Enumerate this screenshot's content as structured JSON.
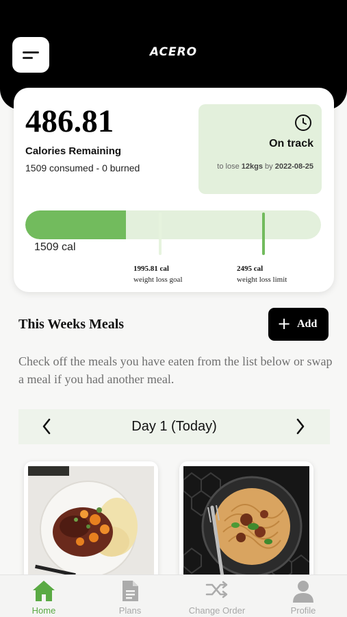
{
  "header": {
    "app_title": "ACERO"
  },
  "summary": {
    "calories_remaining_value": "486.81",
    "calories_remaining_label": "Calories Remaining",
    "consumed_burned": "1509 consumed - 0 burned",
    "status": "On track",
    "goal_prefix": "to lose",
    "goal_amount": "12kgs",
    "goal_by": "by",
    "goal_date": "2022-08-25",
    "progress_fraction": 0.34,
    "consumed_label": "1509 cal",
    "goal_value": "1995.81 cal",
    "goal_text": "weight loss goal",
    "limit_value": "2495 cal",
    "limit_text": "weight loss limit"
  },
  "meals": {
    "title": "This Weeks Meals",
    "add_label": "Add",
    "description": "Check off the meals you have eaten from the list below or swap a meal if you had another meal.",
    "day_label": "Day 1 (Today)"
  },
  "tabs": [
    {
      "label": "Home",
      "icon": "home-icon",
      "active": true
    },
    {
      "label": "Plans",
      "icon": "document-icon",
      "active": false
    },
    {
      "label": "Change Order",
      "icon": "shuffle-icon",
      "active": false
    },
    {
      "label": "Profile",
      "icon": "user-icon",
      "active": false
    }
  ],
  "colors": {
    "accent": "#72bb5d",
    "accent_light": "#e3f0dc",
    "header": "#000000",
    "active_tab": "#5aaa44"
  }
}
